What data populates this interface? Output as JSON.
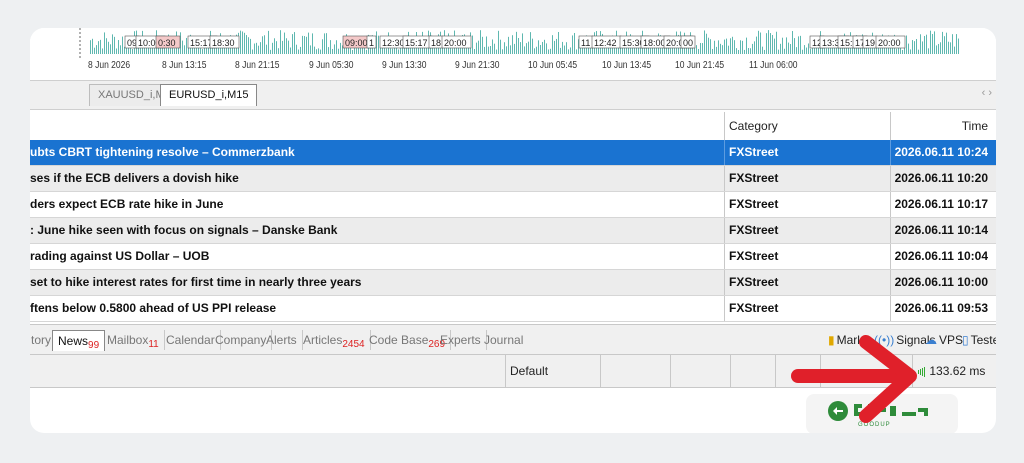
{
  "chart": {
    "markers": [
      "09",
      "10:00",
      "0:30",
      "15:17",
      "18:30",
      "09:00",
      "1",
      "12:30",
      "15:17",
      "18",
      "20:00",
      "11",
      "12:42",
      "15:30",
      "18:00",
      "20:00",
      "00",
      "12",
      "13:30",
      "15:3",
      "17",
      "19",
      "20:00"
    ],
    "time_axis": [
      "8 Jun 2026",
      "8 Jun 13:15",
      "8 Jun 21:15",
      "9 Jun 05:30",
      "9 Jun 13:30",
      "9 Jun 21:30",
      "10 Jun 05:45",
      "10 Jun 13:45",
      "10 Jun 21:45",
      "11 Jun 06:00"
    ]
  },
  "chart_tabs": [
    "XAUUSD_i,M1",
    "EURUSD_i,M15"
  ],
  "news": {
    "headers": {
      "category": "Category",
      "time": "Time"
    },
    "rows": [
      {
        "title": "ubts CBRT tightening resolve – Commerzbank",
        "category": "FXStreet",
        "time": "2026.06.11 10:24"
      },
      {
        "title": "ses if the ECB delivers a dovish hike",
        "category": "FXStreet",
        "time": "2026.06.11 10:20"
      },
      {
        "title": "ders expect ECB rate hike in June",
        "category": "FXStreet",
        "time": "2026.06.11 10:17"
      },
      {
        "title": ": June hike seen with focus on signals – Danske Bank",
        "category": "FXStreet",
        "time": "2026.06.11 10:14"
      },
      {
        "title": "rading against US Dollar – UOB",
        "category": "FXStreet",
        "time": "2026.06.11 10:04"
      },
      {
        "title": " set to hike interest rates for first time in nearly three years",
        "category": "FXStreet",
        "time": "2026.06.11 10:00"
      },
      {
        "title": "ftens below 0.5800 ahead of US PPI release",
        "category": "FXStreet",
        "time": "2026.06.11 09:53"
      }
    ]
  },
  "toolbox": {
    "tabs": [
      {
        "label": "tory",
        "badge": ""
      },
      {
        "label": "News",
        "badge": "99"
      },
      {
        "label": "Mailbox",
        "badge": "11"
      },
      {
        "label": "Calendar",
        "badge": ""
      },
      {
        "label": "Company",
        "badge": ""
      },
      {
        "label": "Alerts",
        "badge": ""
      },
      {
        "label": "Articles",
        "badge": "2454"
      },
      {
        "label": "Code Base",
        "badge": "269"
      },
      {
        "label": "Experts",
        "badge": ""
      },
      {
        "label": "Journal",
        "badge": ""
      }
    ],
    "services": {
      "market": "Mark",
      "signals": "Signals",
      "vps": "VPS",
      "tester": "Teste"
    }
  },
  "status": {
    "profile": "Default",
    "ping": "133.62 ms"
  },
  "logo": {
    "text": "GOODUP"
  },
  "colors": {
    "selected_row": "#1a73d1",
    "chart_bars": "#5fb8b0",
    "badge": "#dd2222",
    "arrow": "#e0202a",
    "logo_green": "#2e8b3a"
  }
}
